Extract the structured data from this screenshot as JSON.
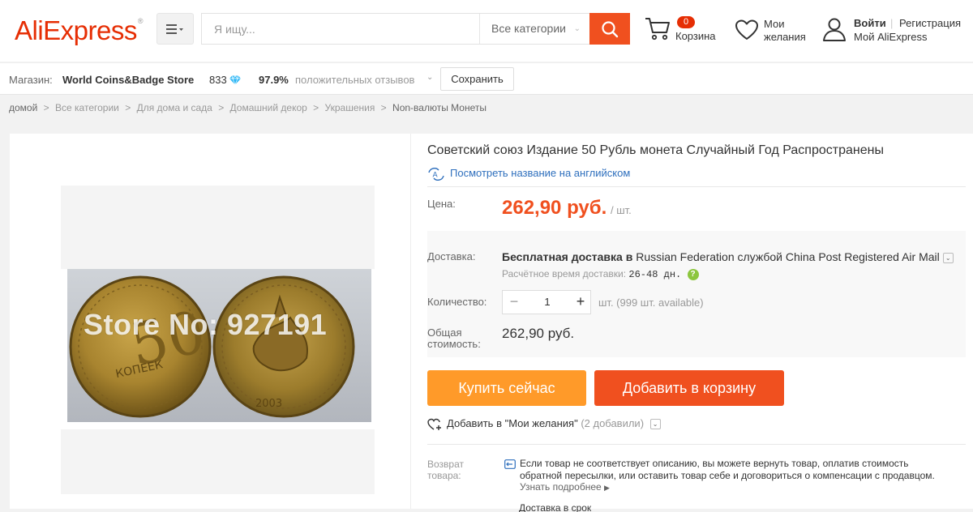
{
  "header": {
    "logo_text": "AliExpress",
    "logo_reg": "®",
    "search_placeholder": "Я ищу...",
    "search_category": "Все категории",
    "cart_count": "0",
    "cart_label": "Корзина",
    "wishlist_label_1": "Мои",
    "wishlist_label_2": "желания",
    "login": "Войти",
    "register": "Регистрация",
    "my_account": "Мой AliExpress"
  },
  "store": {
    "label": "Магазин:",
    "name": "World Coins&Badge Store",
    "rating_count": "833",
    "feedback_percent": "97.9%",
    "feedback_text": "положительных отзывов",
    "save_label": "Сохранить"
  },
  "breadcrumb": [
    "домой",
    "Все категории",
    "Для дома и сада",
    "Домашний декор",
    "Украшения",
    "Non-валюты Монеты"
  ],
  "breadcrumb_sep": ">",
  "product": {
    "image_watermark": "Store No: 927191",
    "title": "Советский союз Издание 50 Рубль монета Случайный Год Распространены",
    "translate_link": "Посмотреть название на английском",
    "price_label": "Цена:",
    "price": "262,90 руб.",
    "price_unit": "/ шт.",
    "shipping_label": "Доставка:",
    "shipping_free": "Бесплатная доставка в",
    "shipping_rest": " Russian Federation службой China Post Registered Air Mail",
    "delivery_time_label": "Расчётное время доставки:",
    "delivery_days": "26-48 дн.",
    "quantity_label": "Количество:",
    "quantity_value": "1",
    "quantity_available": "шт. (999 шт. available)",
    "total_label": "Общая стоимость:",
    "total_value": "262,90 руб.",
    "buy_now": "Купить сейчас",
    "add_to_cart": "Добавить в корзину",
    "add_to_wishlist": "Добавить в \"Мои желания\"",
    "wishlist_count": "(2 добавили)",
    "return_label": "Возврат товара:",
    "return_text": "Если товар не соответствует описанию, вы можете вернуть товар, оплатив стоимость обратной пересылки, или оставить товар себе и договориться о компенсации с продавцом.",
    "return_more": "Узнать подробнее",
    "next_row_partial": "Доставка в срок"
  },
  "colors": {
    "brand": "#e62e04",
    "price": "#f0501f",
    "buy_now": "#ff9a29",
    "add_to_cart": "#f0501f",
    "link": "#2e6fbd"
  }
}
